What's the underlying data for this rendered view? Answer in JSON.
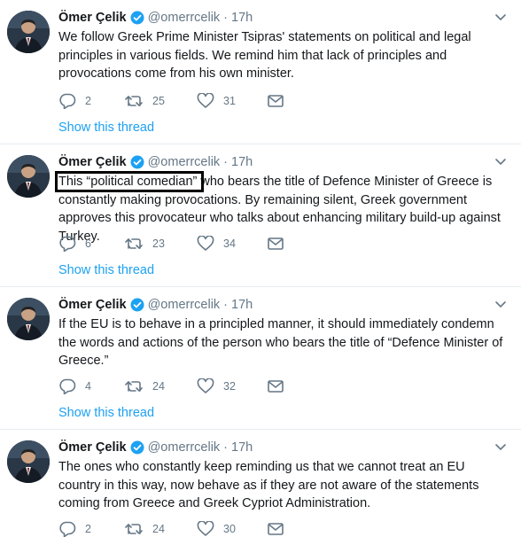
{
  "tweets": [
    {
      "author": "Ömer Çelik",
      "handle": "@omerrcelik",
      "dot": "·",
      "time": "17h",
      "text": "We follow Greek Prime Minister Tsipras' statements on political and legal principles in various fields. We remind him that lack of principles and provocations come from his own minister.",
      "replies": "2",
      "retweets": "25",
      "likes": "31",
      "show_thread": "Show this thread"
    },
    {
      "author": "Ömer Çelik",
      "handle": "@omerrcelik",
      "dot": "·",
      "time": "17h",
      "text_highlight": "This “political comedian” ",
      "text_rest": "who bears the title of Defence Minister of Greece is constantly making provocations. By remaining silent, Greek government approves this provocateur who talks about enhancing military build-up against Turkey.",
      "replies": "6",
      "retweets": "23",
      "likes": "34",
      "show_thread": "Show this thread"
    },
    {
      "author": "Ömer Çelik",
      "handle": "@omerrcelik",
      "dot": "·",
      "time": "17h",
      "text": "If the EU is to behave in a principled manner, it should immediately condemn the words and actions of the person who bears the title of “Defence Minister of Greece.”",
      "replies": "4",
      "retweets": "24",
      "likes": "32",
      "show_thread": "Show this thread"
    },
    {
      "author": "Ömer Çelik",
      "handle": "@omerrcelik",
      "dot": "·",
      "time": "17h",
      "text": "The ones who constantly keep reminding us that we cannot treat an EU country in this way, now behave as if they are not aware of the statements coming from Greece and Greek Cypriot Administration.",
      "replies": "2",
      "retweets": "24",
      "likes": "30"
    }
  ],
  "colors": {
    "accent": "#1da1f2",
    "muted": "#657786",
    "text": "#14171a",
    "divider": "#e6ecf0"
  },
  "icons": [
    "avatar",
    "verified-badge-icon",
    "caret-down-icon",
    "reply-icon",
    "retweet-icon",
    "heart-icon",
    "message-icon"
  ]
}
